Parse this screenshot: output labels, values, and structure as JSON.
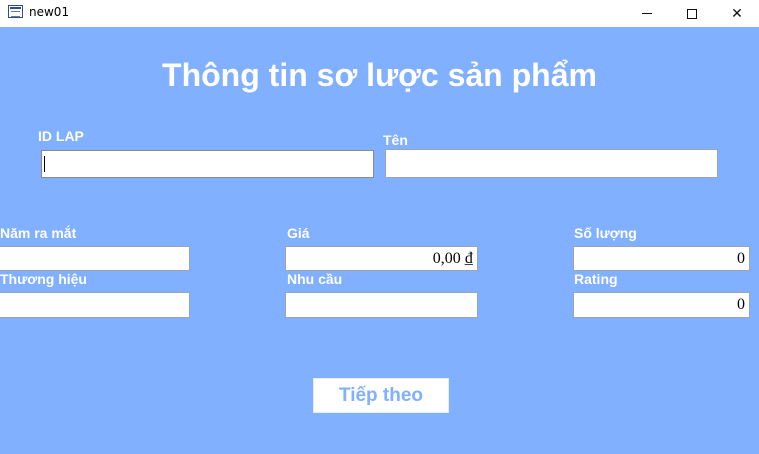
{
  "window": {
    "title": "new01"
  },
  "form": {
    "heading": "Thông tin sơ lược sản phẩm",
    "fields": {
      "id_lap": {
        "label": "ID LAP",
        "value": ""
      },
      "ten": {
        "label": "Tên",
        "value": ""
      },
      "nam_ra_mat": {
        "label": "Năm ra mắt",
        "value": ""
      },
      "gia": {
        "label": "Giá",
        "value": "0,00 ₫"
      },
      "so_luong": {
        "label": "Số lượng",
        "value": "0"
      },
      "thuong_hieu": {
        "label": "Thương hiệu",
        "value": ""
      },
      "nhu_cau": {
        "label": "Nhu cầu",
        "value": ""
      },
      "rating": {
        "label": "Rating",
        "value": "0"
      }
    },
    "next_button": "Tiếp theo"
  },
  "colors": {
    "form_background": "#80b0ff",
    "text": "#ffffff"
  },
  "icons": [
    "form-window-icon",
    "minimize-icon",
    "maximize-icon",
    "close-icon"
  ]
}
